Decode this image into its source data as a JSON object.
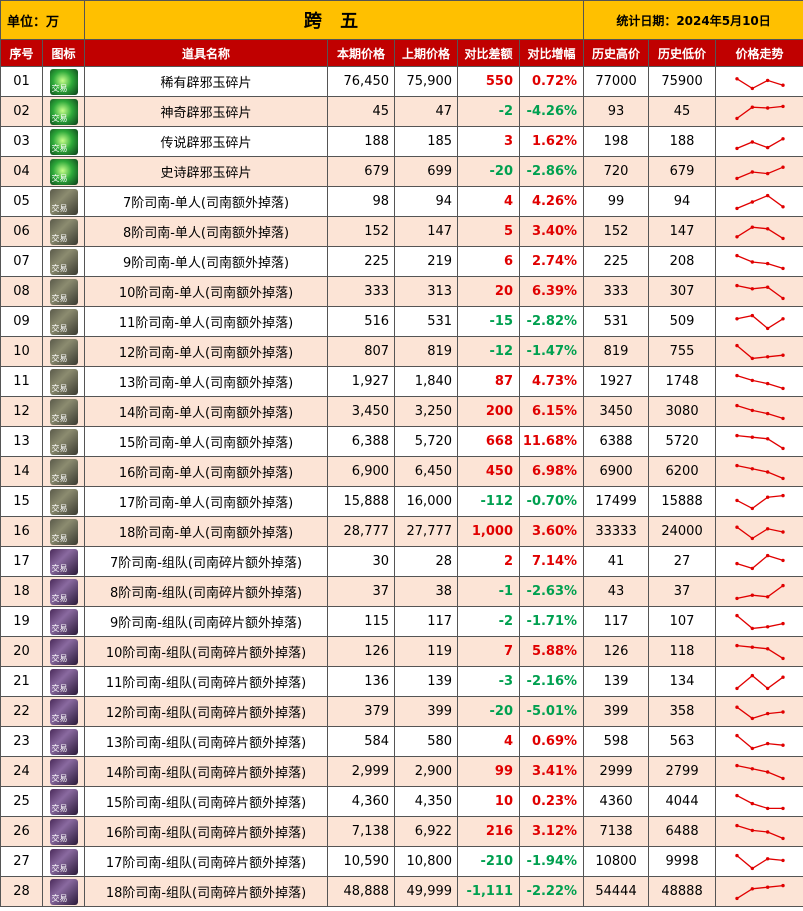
{
  "header": {
    "unit_label": "单位：万",
    "title": "跨 五",
    "date_label": "统计日期：2024年5月10日"
  },
  "columns": [
    "序号",
    "图标",
    "道具名称",
    "本期价格",
    "上期价格",
    "对比差额",
    "对比增幅",
    "历史高价",
    "历史低价",
    "价格走势"
  ],
  "colors": {
    "header_bg": "#ffc000",
    "column_bg": "#c00000",
    "row_alt": "#fce4d6",
    "up": "#e00000",
    "down": "#00a050",
    "trend_line": "#e00000"
  },
  "icon_tag": "交易",
  "rows": [
    {
      "no": "01",
      "icon": "gem-icon",
      "name": "稀有辟邪玉碎片",
      "cur": "76,450",
      "prev": "75,900",
      "diff": "550",
      "pct": "0.72%",
      "dir": "up",
      "high": "77000",
      "low": "75900",
      "trend": [
        0.3,
        0.9,
        0.4,
        0.7
      ]
    },
    {
      "no": "02",
      "icon": "gem-icon",
      "name": "神奇辟邪玉碎片",
      "cur": "45",
      "prev": "47",
      "diff": "-2",
      "pct": "-4.26%",
      "dir": "down",
      "high": "93",
      "low": "45",
      "trend": [
        0.9,
        0.2,
        0.25,
        0.15
      ]
    },
    {
      "no": "03",
      "icon": "gem-icon",
      "name": "传说辟邪玉碎片",
      "cur": "188",
      "prev": "185",
      "diff": "3",
      "pct": "1.62%",
      "dir": "up",
      "high": "198",
      "low": "188",
      "trend": [
        0.9,
        0.5,
        0.85,
        0.3
      ]
    },
    {
      "no": "04",
      "icon": "gem-icon",
      "name": "史诗辟邪玉碎片",
      "cur": "679",
      "prev": "699",
      "diff": "-20",
      "pct": "-2.86%",
      "dir": "down",
      "high": "720",
      "low": "679",
      "trend": [
        0.9,
        0.5,
        0.6,
        0.2
      ]
    },
    {
      "no": "05",
      "icon": "hz-icon",
      "name": "7阶司南-单人(司南额外掉落)",
      "cur": "98",
      "prev": "94",
      "diff": "4",
      "pct": "4.26%",
      "dir": "up",
      "high": "99",
      "low": "94",
      "trend": [
        0.9,
        0.5,
        0.1,
        0.8
      ]
    },
    {
      "no": "06",
      "icon": "hz-icon",
      "name": "8阶司南-单人(司南额外掉落)",
      "cur": "152",
      "prev": "147",
      "diff": "5",
      "pct": "3.40%",
      "dir": "up",
      "high": "152",
      "low": "147",
      "trend": [
        0.8,
        0.2,
        0.3,
        0.9
      ]
    },
    {
      "no": "07",
      "icon": "hz-icon",
      "name": "9阶司南-单人(司南额外掉落)",
      "cur": "225",
      "prev": "219",
      "diff": "6",
      "pct": "2.74%",
      "dir": "up",
      "high": "225",
      "low": "208",
      "trend": [
        0.1,
        0.5,
        0.6,
        0.9
      ]
    },
    {
      "no": "08",
      "icon": "hz-icon",
      "name": "10阶司南-单人(司南额外掉落)",
      "cur": "333",
      "prev": "313",
      "diff": "20",
      "pct": "6.39%",
      "dir": "up",
      "high": "333",
      "low": "307",
      "trend": [
        0.1,
        0.3,
        0.2,
        0.9
      ]
    },
    {
      "no": "09",
      "icon": "hz-icon",
      "name": "11阶司南-单人(司南额外掉落)",
      "cur": "516",
      "prev": "531",
      "diff": "-15",
      "pct": "-2.82%",
      "dir": "down",
      "high": "531",
      "low": "509",
      "trend": [
        0.3,
        0.1,
        0.9,
        0.3
      ]
    },
    {
      "no": "10",
      "icon": "hz-icon",
      "name": "12阶司南-单人(司南额外掉落)",
      "cur": "807",
      "prev": "819",
      "diff": "-12",
      "pct": "-1.47%",
      "dir": "down",
      "high": "819",
      "low": "755",
      "trend": [
        0.1,
        0.9,
        0.8,
        0.7
      ]
    },
    {
      "no": "11",
      "icon": "hz-icon",
      "name": "13阶司南-单人(司南额外掉落)",
      "cur": "1,927",
      "prev": "1,840",
      "diff": "87",
      "pct": "4.73%",
      "dir": "up",
      "high": "1927",
      "low": "1748",
      "trend": [
        0.1,
        0.4,
        0.6,
        0.9
      ]
    },
    {
      "no": "12",
      "icon": "hz-icon",
      "name": "14阶司南-单人(司南额外掉落)",
      "cur": "3,450",
      "prev": "3,250",
      "diff": "200",
      "pct": "6.15%",
      "dir": "up",
      "high": "3450",
      "low": "3080",
      "trend": [
        0.1,
        0.4,
        0.6,
        0.9
      ]
    },
    {
      "no": "13",
      "icon": "hz-icon",
      "name": "15阶司南-单人(司南额外掉落)",
      "cur": "6,388",
      "prev": "5,720",
      "diff": "668",
      "pct": "11.68%",
      "dir": "up",
      "high": "6388",
      "low": "5720",
      "trend": [
        0.1,
        0.2,
        0.3,
        0.9
      ]
    },
    {
      "no": "14",
      "icon": "hz-icon",
      "name": "16阶司南-单人(司南额外掉落)",
      "cur": "6,900",
      "prev": "6,450",
      "diff": "450",
      "pct": "6.98%",
      "dir": "up",
      "high": "6900",
      "low": "6200",
      "trend": [
        0.1,
        0.3,
        0.5,
        0.9
      ]
    },
    {
      "no": "15",
      "icon": "hz-icon",
      "name": "17阶司南-单人(司南额外掉落)",
      "cur": "15,888",
      "prev": "16,000",
      "diff": "-112",
      "pct": "-0.70%",
      "dir": "down",
      "high": "17499",
      "low": "15888",
      "trend": [
        0.4,
        0.9,
        0.2,
        0.1
      ]
    },
    {
      "no": "16",
      "icon": "hz-icon",
      "name": "18阶司南-单人(司南额外掉落)",
      "cur": "28,777",
      "prev": "27,777",
      "diff": "1,000",
      "pct": "3.60%",
      "dir": "up",
      "high": "33333",
      "low": "24000",
      "trend": [
        0.2,
        0.9,
        0.3,
        0.5
      ]
    },
    {
      "no": "17",
      "icon": "team-icon",
      "name": "7阶司南-组队(司南碎片额外掉落)",
      "cur": "30",
      "prev": "28",
      "diff": "2",
      "pct": "7.14%",
      "dir": "up",
      "high": "41",
      "low": "27",
      "trend": [
        0.6,
        0.9,
        0.1,
        0.4
      ]
    },
    {
      "no": "18",
      "icon": "team-icon",
      "name": "8阶司南-组队(司南碎片额外掉落)",
      "cur": "37",
      "prev": "38",
      "diff": "-1",
      "pct": "-2.63%",
      "dir": "down",
      "high": "43",
      "low": "37",
      "trend": [
        0.9,
        0.7,
        0.8,
        0.1
      ]
    },
    {
      "no": "19",
      "icon": "team-icon",
      "name": "9阶司南-组队(司南碎片额外掉落)",
      "cur": "115",
      "prev": "117",
      "diff": "-2",
      "pct": "-1.71%",
      "dir": "down",
      "high": "117",
      "low": "107",
      "trend": [
        0.1,
        0.9,
        0.8,
        0.6
      ]
    },
    {
      "no": "20",
      "icon": "team-icon",
      "name": "10阶司南-组队(司南碎片额外掉落)",
      "cur": "126",
      "prev": "119",
      "diff": "7",
      "pct": "5.88%",
      "dir": "up",
      "high": "126",
      "low": "118",
      "trend": [
        0.1,
        0.2,
        0.3,
        0.9
      ]
    },
    {
      "no": "21",
      "icon": "team-icon",
      "name": "11阶司南-组队(司南碎片额外掉落)",
      "cur": "136",
      "prev": "139",
      "diff": "-3",
      "pct": "-2.16%",
      "dir": "down",
      "high": "139",
      "low": "134",
      "trend": [
        0.9,
        0.1,
        0.9,
        0.2
      ]
    },
    {
      "no": "22",
      "icon": "team-icon",
      "name": "12阶司南-组队(司南碎片额外掉落)",
      "cur": "379",
      "prev": "399",
      "diff": "-20",
      "pct": "-5.01%",
      "dir": "down",
      "high": "399",
      "low": "358",
      "trend": [
        0.2,
        0.9,
        0.6,
        0.5
      ]
    },
    {
      "no": "23",
      "icon": "team-icon",
      "name": "13阶司南-组队(司南碎片额外掉落)",
      "cur": "584",
      "prev": "580",
      "diff": "4",
      "pct": "0.69%",
      "dir": "up",
      "high": "598",
      "low": "563",
      "trend": [
        0.1,
        0.9,
        0.6,
        0.7
      ]
    },
    {
      "no": "24",
      "icon": "team-icon",
      "name": "14阶司南-组队(司南碎片额外掉落)",
      "cur": "2,999",
      "prev": "2,900",
      "diff": "99",
      "pct": "3.41%",
      "dir": "up",
      "high": "2999",
      "low": "2799",
      "trend": [
        0.1,
        0.3,
        0.5,
        0.9
      ]
    },
    {
      "no": "25",
      "icon": "team-icon",
      "name": "15阶司南-组队(司南碎片额外掉落)",
      "cur": "4,360",
      "prev": "4,350",
      "diff": "10",
      "pct": "0.23%",
      "dir": "up",
      "high": "4360",
      "low": "4044",
      "trend": [
        0.1,
        0.6,
        0.9,
        0.9
      ]
    },
    {
      "no": "26",
      "icon": "team-icon",
      "name": "16阶司南-组队(司南碎片额外掉落)",
      "cur": "7,138",
      "prev": "6,922",
      "diff": "216",
      "pct": "3.12%",
      "dir": "up",
      "high": "7138",
      "low": "6488",
      "trend": [
        0.1,
        0.4,
        0.5,
        0.9
      ]
    },
    {
      "no": "27",
      "icon": "team-icon",
      "name": "17阶司南-组队(司南碎片额外掉落)",
      "cur": "10,590",
      "prev": "10,800",
      "diff": "-210",
      "pct": "-1.94%",
      "dir": "down",
      "high": "10800",
      "low": "9998",
      "trend": [
        0.1,
        0.9,
        0.3,
        0.4
      ]
    },
    {
      "no": "28",
      "icon": "team-icon",
      "name": "18阶司南-组队(司南碎片额外掉落)",
      "cur": "48,888",
      "prev": "49,999",
      "diff": "-1,111",
      "pct": "-2.22%",
      "dir": "down",
      "high": "54444",
      "low": "48888",
      "trend": [
        0.9,
        0.3,
        0.2,
        0.1
      ]
    }
  ]
}
